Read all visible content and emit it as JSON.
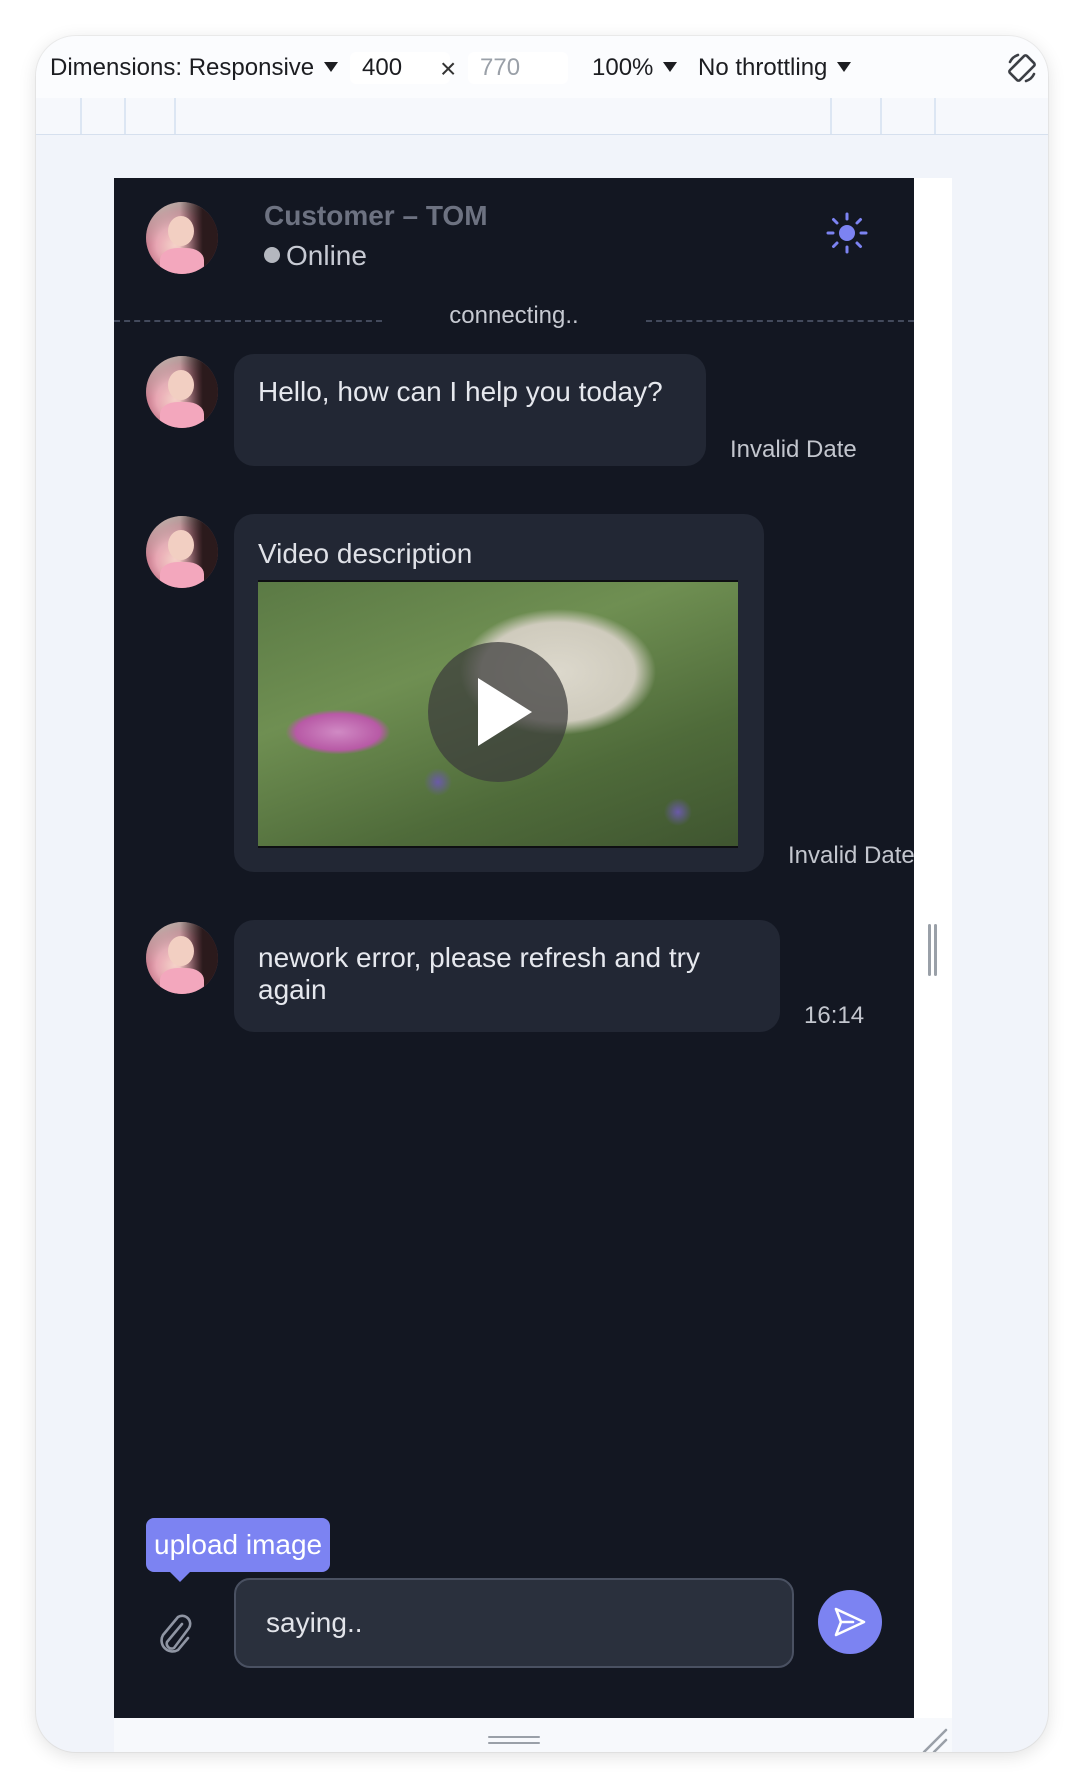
{
  "devtools": {
    "dimensions_label": "Dimensions: Responsive",
    "width_value": "400",
    "height_placeholder": "770",
    "times_symbol": "×",
    "zoom": "100%",
    "throttling": "No throttling"
  },
  "header": {
    "name": "Customer – TOM",
    "status": "Online",
    "connection": "connecting.."
  },
  "messages": [
    {
      "text": "Hello, how can I help you today?",
      "time": "Invalid Date"
    },
    {
      "video_description": "Video description",
      "time": "Invalid Date"
    },
    {
      "text": "nework error, please refresh and try again",
      "time": "16:14"
    }
  ],
  "composer": {
    "tooltip": "upload image",
    "placeholder": "saying.."
  },
  "colors": {
    "accent": "#7c83f2",
    "background": "#131722",
    "bubble": "#222734"
  },
  "icons": [
    "sun-icon",
    "paperclip-icon",
    "send-icon",
    "play-icon",
    "rotate-icon",
    "status-dot-icon"
  ]
}
